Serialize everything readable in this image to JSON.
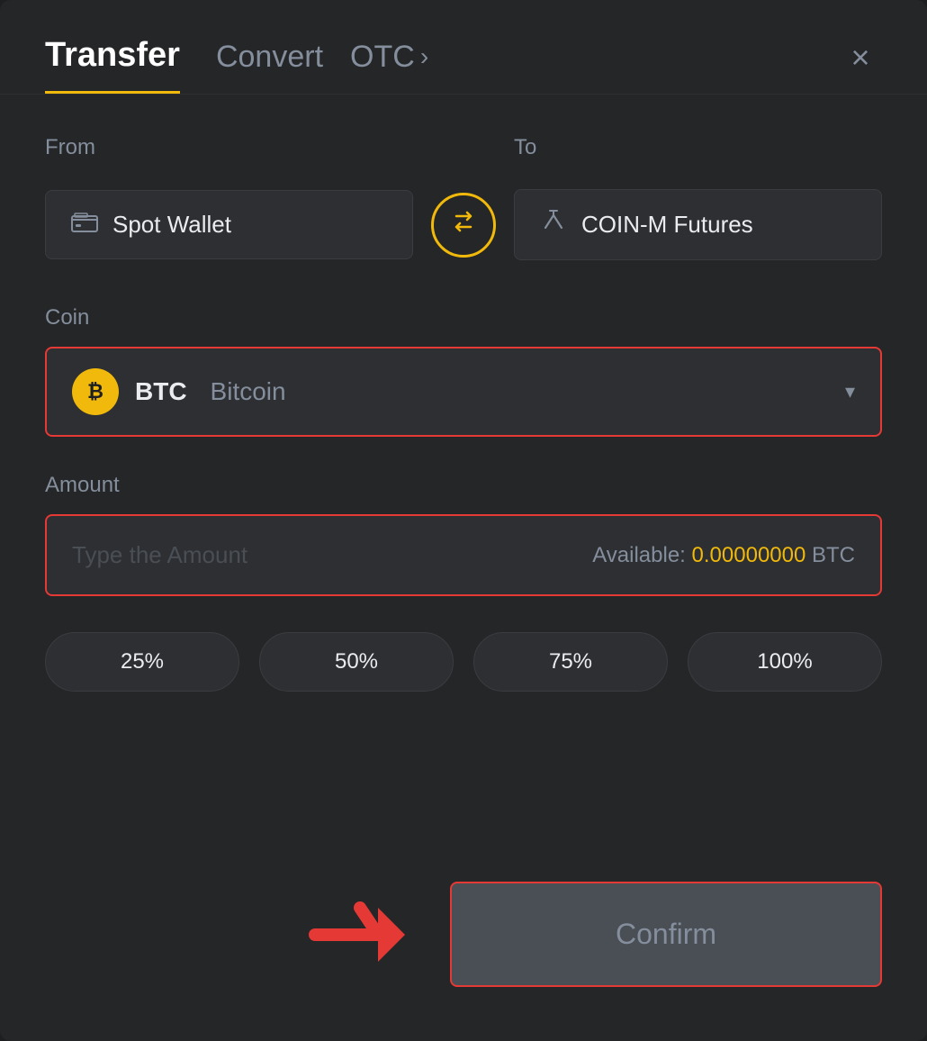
{
  "header": {
    "tab_transfer": "Transfer",
    "tab_convert": "Convert",
    "tab_otc": "OTC",
    "close_label": "×"
  },
  "from_section": {
    "label": "From",
    "wallet_icon": "▣",
    "wallet_name": "Spot Wallet"
  },
  "to_section": {
    "label": "To",
    "futures_icon": "↑",
    "futures_name": "COIN-M Futures"
  },
  "coin_section": {
    "label": "Coin",
    "coin_symbol": "BTC",
    "coin_name": "Bitcoin",
    "btc_icon": "₿"
  },
  "amount_section": {
    "label": "Amount",
    "placeholder": "Type the Amount",
    "available_label": "Available:",
    "available_amount": "0.00000000",
    "available_currency": "BTC"
  },
  "percentage_buttons": [
    {
      "label": "25%"
    },
    {
      "label": "50%"
    },
    {
      "label": "75%"
    },
    {
      "label": "100%"
    }
  ],
  "confirm_button": {
    "label": "Confirm"
  },
  "colors": {
    "accent": "#f0b90b",
    "danger": "#e53935",
    "text_primary": "#eaecef",
    "text_secondary": "#848e9c",
    "bg_input": "#2d2f32"
  }
}
